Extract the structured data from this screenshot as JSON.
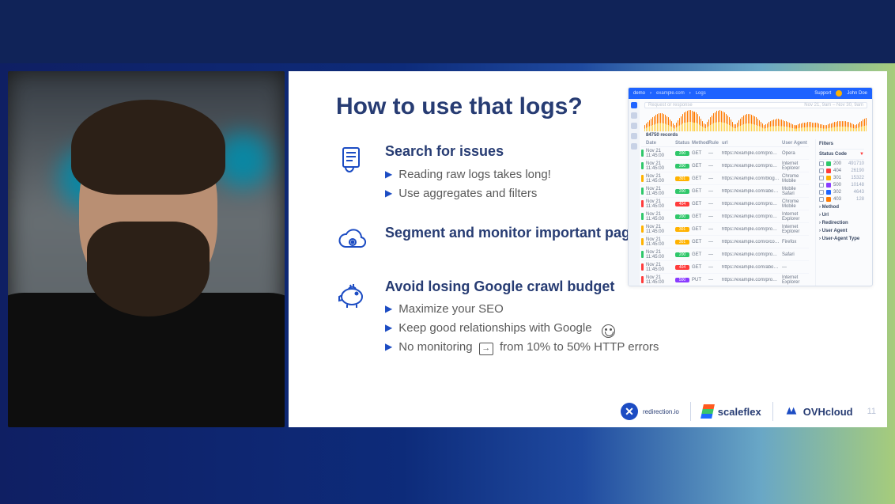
{
  "slide": {
    "title": "How to use that logs?",
    "sections": [
      {
        "heading": "Search for issues",
        "bullets": [
          "Reading raw logs takes long!",
          "Use aggregates and filters"
        ]
      },
      {
        "heading": "Segment and monitor important pages",
        "bullets": []
      },
      {
        "heading": "Avoid losing Google crawl budget",
        "bullets": [
          "Maximize your SEO",
          "Keep good relationships with Google",
          "No monitoring → from 10% to 50% HTTP errors"
        ]
      }
    ],
    "page_number": "11"
  },
  "sponsors": {
    "a": "redirection.io",
    "b": "scaleflex",
    "c": "OVHcloud"
  },
  "app": {
    "product": "demo",
    "breadcrumb1": "example.com",
    "breadcrumb2": "Logs",
    "support": "Support",
    "user": "John Doe",
    "search_placeholder": "Request or response",
    "date_range": "Nov 21, 9am – Nov 30, 9am",
    "records": "84750 records",
    "columns": {
      "date": "Date",
      "status": "Status",
      "method": "Method",
      "rule": "Rule",
      "url": "url",
      "agent": "User Agent"
    },
    "rows": [
      {
        "bar": "g",
        "date": "Nov 21  11:45:00",
        "status": "200",
        "cls": "b200",
        "method": "GET",
        "url": "https://example.com/products/photo-editing-translator-spin-flight-accreditation",
        "agent": "Opera"
      },
      {
        "bar": "g",
        "date": "Nov 21  11:45:00",
        "status": "200",
        "cls": "b200",
        "method": "GET",
        "url": "https://example.com/products/sporting-goods-collection?q=category-blue",
        "agent": "Internet Explorer"
      },
      {
        "bar": "y",
        "date": "Nov 21  11:45:00",
        "status": "301",
        "cls": "b301",
        "method": "GET",
        "url": "https://example.com/blog/sporting-goods-kids-tex-recreation-halloween",
        "agent": "Chrome Mobile"
      },
      {
        "bar": "g",
        "date": "Nov 21  11:45:00",
        "status": "200",
        "cls": "b200",
        "method": "GET",
        "url": "https://example.com/about/business-model-set-out-gone-extranet.org",
        "agent": "Mobile Safari"
      },
      {
        "bar": "r",
        "date": "Nov 21  11:45:00",
        "status": "404",
        "cls": "b404",
        "method": "GET",
        "url": "https://example.com/products/discovery-bike-art",
        "agent": "Chrome Mobile"
      },
      {
        "bar": "g",
        "date": "Nov 21  11:45:00",
        "status": "200",
        "cls": "b200",
        "method": "GET",
        "url": "https://example.com/products/Cameras-Optics/Photography/Darkroom/Developer",
        "agent": "Internet Explorer"
      },
      {
        "bar": "y",
        "date": "Nov 21  11:45:00",
        "status": "301",
        "cls": "b301",
        "method": "GET",
        "url": "https://example.com/products/tar-compaction/Protest-Tips/Crucial-Wonder",
        "agent": "Internet Explorer"
      },
      {
        "bar": "y",
        "date": "Nov 21  11:45:00",
        "status": "301",
        "cls": "b301",
        "method": "GET",
        "url": "https://example.com/o/connection-guard-administration-class-reduction",
        "agent": "Firefox"
      },
      {
        "bar": "g",
        "date": "Nov 21  11:45:00",
        "status": "200",
        "cls": "b200",
        "method": "GET",
        "url": "https://example.com/products/Buffer-Polysurveyor-suppl/tar-Lane-six",
        "agent": "Safari"
      },
      {
        "bar": "r",
        "date": "Nov 21  11:45:00",
        "status": "404",
        "cls": "b404",
        "method": "GET",
        "url": "https://example.com/about/urban-design",
        "agent": "—"
      },
      {
        "bar": "r",
        "date": "Nov 21  11:45:00",
        "status": "500",
        "cls": "b500",
        "method": "PUT",
        "url": "https://example.com/products/Home-Garden/Household-Supplies/Storage",
        "agent": "Internet Explorer"
      },
      {
        "bar": "g",
        "date": "Nov 21  11:45:00",
        "status": "200",
        "cls": "b200",
        "method": "GET",
        "url": "https://example.com/products/Armory-Weapons-Gun-Care-Accessories/Gun",
        "agent": "Firefox"
      }
    ],
    "filters": {
      "title": "Filters",
      "status_title": "Status Code",
      "status": [
        {
          "label": "200",
          "color": "#2fc76a",
          "count": "491710"
        },
        {
          "label": "404",
          "color": "#ff3b3b",
          "count": "26190"
        },
        {
          "label": "301",
          "color": "#ffb200",
          "count": "15322"
        },
        {
          "label": "500",
          "color": "#8a3bff",
          "count": "10148"
        },
        {
          "label": "302",
          "color": "#1e63ff",
          "count": "4643"
        },
        {
          "label": "403",
          "color": "#ff7a00",
          "count": "128"
        }
      ],
      "groups": [
        "Method",
        "Url",
        "Redirection",
        "User Agent",
        "User-Agent Type"
      ]
    }
  }
}
